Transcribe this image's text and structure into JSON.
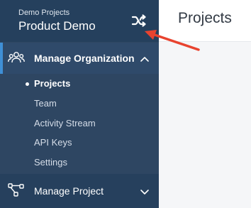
{
  "org_switcher": {
    "parent_label": "Demo Projects",
    "project_name": "Product Demo",
    "switch_icon": "shuffle-icon"
  },
  "sidebar": {
    "manage_organization": {
      "label": "Manage Organization",
      "icon": "users-icon",
      "expanded": true,
      "items": [
        {
          "label": "Projects",
          "active": true
        },
        {
          "label": "Team",
          "active": false
        },
        {
          "label": "Activity Stream",
          "active": false
        },
        {
          "label": "API Keys",
          "active": false
        },
        {
          "label": "Settings",
          "active": false
        }
      ]
    },
    "manage_project": {
      "label": "Manage Project",
      "icon": "nodes-icon",
      "expanded": false
    }
  },
  "main": {
    "title": "Projects"
  },
  "annotation": {
    "arrow_color": "#e8432f"
  },
  "colors": {
    "sidebar_bg": "#2e4662",
    "header_bg": "#25405d",
    "accent": "#3f8fd6"
  }
}
